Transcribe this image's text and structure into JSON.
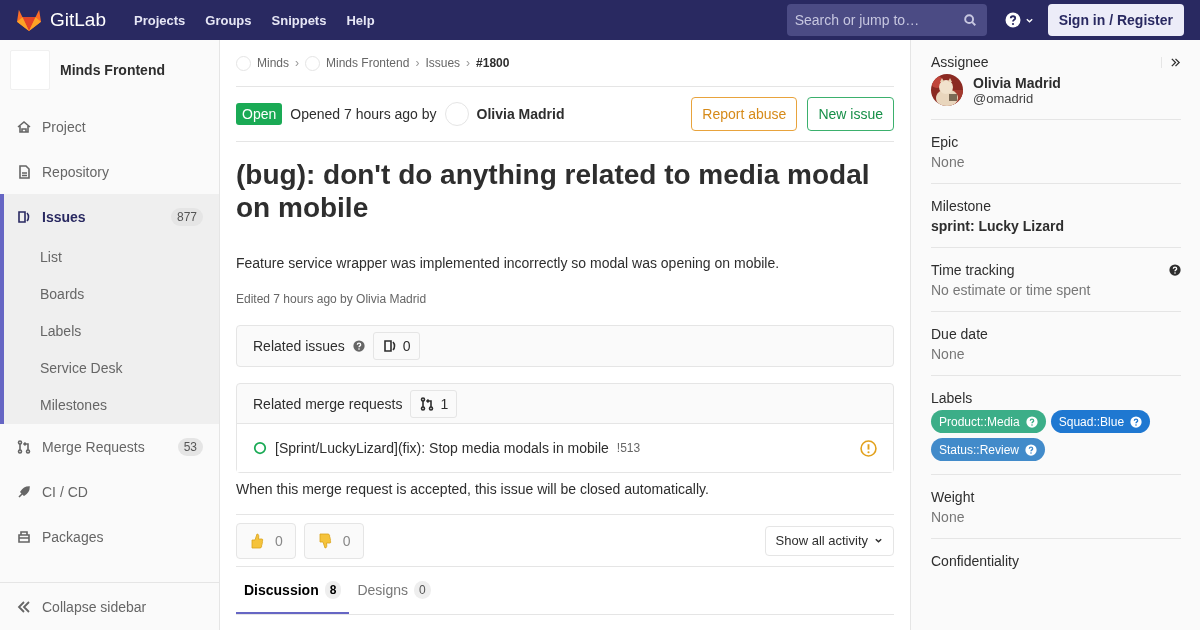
{
  "header": {
    "brand": "GitLab",
    "nav": [
      "Projects",
      "Groups",
      "Snippets",
      "Help"
    ],
    "search": {
      "placeholder": "Search or jump to…"
    },
    "sign_in": "Sign in / Register"
  },
  "sidebar": {
    "project_name": "Minds Frontend",
    "items": [
      {
        "label": "Project",
        "selected": false
      },
      {
        "label": "Repository",
        "selected": false
      },
      {
        "label": "Issues",
        "count": "877",
        "selected": true,
        "children": [
          {
            "label": "List",
            "selected": false
          },
          {
            "label": "Boards",
            "selected": false
          },
          {
            "label": "Labels",
            "selected": false
          },
          {
            "label": "Service Desk",
            "selected": false
          },
          {
            "label": "Milestones",
            "selected": false
          }
        ]
      },
      {
        "label": "Merge Requests",
        "count": "53",
        "selected": false
      },
      {
        "label": "CI / CD",
        "selected": false
      },
      {
        "label": "Packages",
        "selected": false
      }
    ],
    "collapse": "Collapse sidebar"
  },
  "breadcrumbs": [
    {
      "label": "Minds",
      "avatar": true
    },
    {
      "sep": "›",
      "label": "Minds Frontend",
      "avatar": true
    },
    {
      "sep": "›",
      "label": "Issues",
      "avatar": false
    },
    {
      "sep": "›",
      "label": "#1800",
      "avatar": false
    }
  ],
  "issue": {
    "status": "Open",
    "opened": "Opened 7 hours ago by",
    "author": "Olivia Madrid",
    "actions": [
      {
        "label": "Report abuse",
        "kind": "warning"
      },
      {
        "label": "New issue",
        "kind": "success"
      }
    ],
    "title": "(bug): don't do anything related to media modal on mobile",
    "description": "Feature service wrapper was implemented incorrectly so modal was opening on mobile.",
    "edited": "Edited 7 hours ago by Olivia Madrid"
  },
  "related_issues": {
    "title": "Related issues",
    "count": "0"
  },
  "related_merge_requests": {
    "title": "Related merge requests",
    "count": "1",
    "items": [
      {
        "title": "[Sprint/LuckyLizard](fix): Stop media modals in mobile",
        "ref": "!513"
      }
    ]
  },
  "closing_note": "When this merge request is accepted, this issue will be closed automatically.",
  "reactions": [
    {
      "kind": "thumbsup",
      "count": "0"
    },
    {
      "kind": "thumbsdown",
      "count": "0"
    }
  ],
  "activity_filter": "Show all activity",
  "tabs": [
    {
      "label": "Discussion",
      "count": "8",
      "selected": true
    },
    {
      "label": "Designs",
      "count": "0",
      "selected": false
    }
  ],
  "right_sidebar": {
    "assignee": {
      "heading": "Assignee",
      "name": "Olivia Madrid",
      "username": "@omadrid"
    },
    "sections": [
      {
        "heading": "Epic",
        "value": "None",
        "kind": "muted",
        "help": false
      },
      {
        "heading": "Milestone",
        "value": "sprint: Lucky Lizard",
        "kind": "bold",
        "help": false
      },
      {
        "heading": "Time tracking",
        "value": "No estimate or time spent",
        "kind": "muted",
        "help": true
      },
      {
        "heading": "Due date",
        "value": "None",
        "kind": "muted",
        "help": false
      }
    ],
    "labels": {
      "heading": "Labels",
      "items": [
        {
          "label": "Product::Media",
          "color": "#3cae88"
        },
        {
          "label": "Squad::Blue",
          "color": "#1f78d1"
        },
        {
          "label": "Status::Review",
          "color": "#428bca"
        }
      ]
    },
    "weight": {
      "heading": "Weight",
      "value": "None"
    },
    "confidentiality": {
      "heading": "Confidentiality"
    }
  }
}
